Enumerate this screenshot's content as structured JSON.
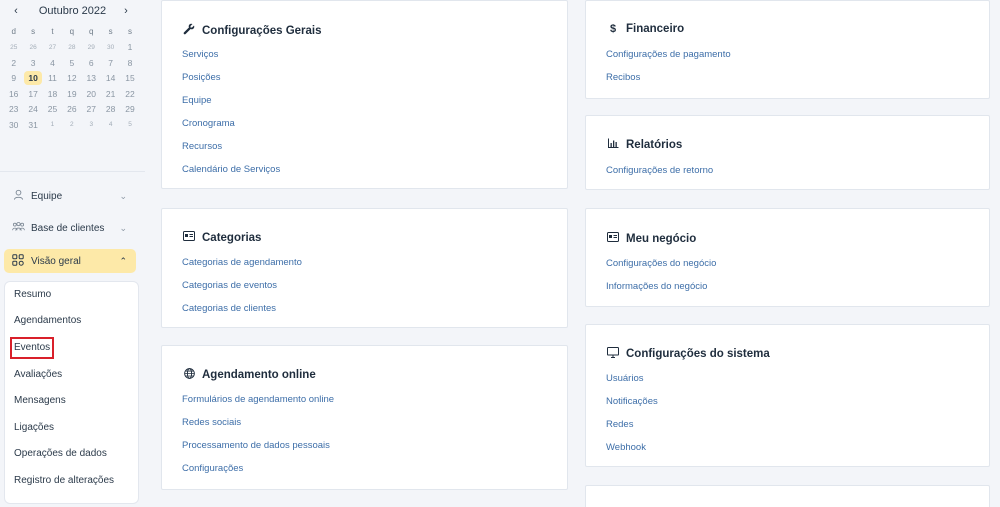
{
  "calendar": {
    "month_label": "Outubro 2022",
    "prev": "‹",
    "next": "›",
    "weekdays": [
      "d",
      "s",
      "t",
      "q",
      "q",
      "s",
      "s"
    ],
    "weeks": [
      [
        "25",
        "26",
        "27",
        "28",
        "29",
        "30",
        "1"
      ],
      [
        "2",
        "3",
        "4",
        "5",
        "6",
        "7",
        "8"
      ],
      [
        "9",
        "10",
        "11",
        "12",
        "13",
        "14",
        "15"
      ],
      [
        "16",
        "17",
        "18",
        "19",
        "20",
        "21",
        "22"
      ],
      [
        "23",
        "24",
        "25",
        "26",
        "27",
        "28",
        "29"
      ],
      [
        "30",
        "31",
        "1",
        "2",
        "3",
        "4",
        "5"
      ]
    ],
    "today": "10"
  },
  "sidebar": {
    "items": [
      {
        "label": "Equipe",
        "icon": "user-icon"
      },
      {
        "label": "Base de clientes",
        "icon": "users-icon"
      },
      {
        "label": "Visão geral",
        "icon": "grid-icon"
      }
    ],
    "subitems": [
      "Resumo",
      "Agendamentos",
      "Eventos",
      "Avaliações",
      "Mensagens",
      "Ligações",
      "Operações de dados",
      "Registro de alterações"
    ]
  },
  "cards": {
    "config_gerais": {
      "title": "Configurações Gerais",
      "icon": "wrench-icon",
      "links": [
        "Serviços",
        "Posições",
        "Equipe",
        "Cronograma",
        "Recursos",
        "Calendário de Serviços"
      ]
    },
    "financeiro": {
      "title": "Financeiro",
      "icon": "dollar-icon",
      "links": [
        "Configurações de pagamento",
        "Recibos"
      ]
    },
    "relatorios": {
      "title": "Relatórios",
      "icon": "bar-chart-icon",
      "links": [
        "Configurações de retorno"
      ]
    },
    "categorias": {
      "title": "Categorias",
      "icon": "id-card-icon",
      "links": [
        "Categorias de agendamento",
        "Categorias de eventos",
        "Categorias de clientes"
      ]
    },
    "meu_negocio": {
      "title": "Meu negócio",
      "icon": "id-card-icon",
      "links": [
        "Configurações do negócio",
        "Informações do negócio"
      ]
    },
    "agendamento_online": {
      "title": "Agendamento online",
      "icon": "globe-icon",
      "links": [
        "Formulários de agendamento online",
        "Redes sociais",
        "Processamento de dados pessoais",
        "Configurações"
      ]
    },
    "config_sistema": {
      "title": "Configurações do sistema",
      "icon": "monitor-icon",
      "links": [
        "Usuários",
        "Notificações",
        "Redes",
        "Webhook"
      ]
    }
  }
}
